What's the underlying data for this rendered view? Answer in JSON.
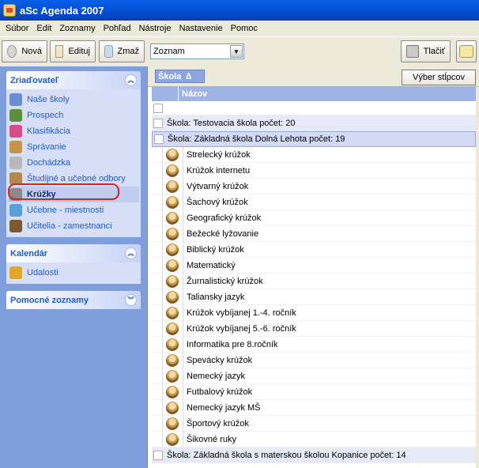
{
  "window": {
    "title": "aSc Agenda 2007"
  },
  "menu": [
    {
      "label": "Súbor",
      "icon": ""
    },
    {
      "label": "Edit",
      "icon": ""
    },
    {
      "label": "Zoznamy",
      "icon": ""
    },
    {
      "label": "Pohľad",
      "icon": ""
    },
    {
      "label": "Nástroje",
      "icon": ""
    },
    {
      "label": "Nastavenie",
      "icon": ""
    },
    {
      "label": "Pomoc",
      "icon": ""
    }
  ],
  "toolbar": {
    "new_label": "Nová",
    "edit_label": "Edituj",
    "delete_label": "Zmaž",
    "view_select": "Zoznam",
    "print_label": "Tlačiť"
  },
  "sidebar": {
    "panels": [
      {
        "title": "Zriaďovateľ",
        "items": [
          {
            "label": "Naše školy",
            "icon": "people-icon",
            "color": "#6a8fd0"
          },
          {
            "label": "Prospech",
            "icon": "grades-icon",
            "color": "#5c8f3c"
          },
          {
            "label": "Klasifikácia",
            "icon": "classification-icon",
            "color": "#d84a8a"
          },
          {
            "label": "Správanie",
            "icon": "behavior-icon",
            "color": "#c69443"
          },
          {
            "label": "Dochádzka",
            "icon": "attendance-icon",
            "color": "#b8b8b8"
          },
          {
            "label": "Študijné a učebné odbory",
            "icon": "book-icon",
            "color": "#b08a4a"
          },
          {
            "label": "Krúžky",
            "icon": "club-icon",
            "color": "#8a8a8a",
            "active": true
          },
          {
            "label": "Učebne - miestnosti",
            "icon": "room-icon",
            "color": "#5aa0d8"
          },
          {
            "label": "Učitelia - zamestnanci",
            "icon": "teacher-icon",
            "color": "#7a5a2a"
          }
        ]
      },
      {
        "title": "Kalendár",
        "items": [
          {
            "label": "Udalosti",
            "icon": "calendar-icon",
            "color": "#e5a626"
          }
        ]
      },
      {
        "title": "Pomocné zoznamy",
        "items": []
      }
    ]
  },
  "main": {
    "group_chip": "Škola",
    "group_chip_sort": "∆",
    "column_chooser": "Výber stĺpcov",
    "column_name": "Názov",
    "groups": [
      {
        "label": "Škola:  Testovacia škola  počet: 20",
        "selected": false,
        "items": []
      },
      {
        "label": "Škola:  Základná škola Dolná Lehota  počet: 19",
        "selected": true,
        "items": [
          "Strelecký krúžok",
          "Krúžok internetu",
          "Výtvarný krúžok",
          "Šachový krúžok",
          "Geografický krúžok",
          "Bežecké lyžovanie",
          "Biblický krúžok",
          "Matematický",
          "Žurnalistický krúžok",
          "Taliansky jazyk",
          "Krúžok vybíjanej 1.-4. ročník",
          "Krúžok vybíjanej 5.-6. ročník",
          "Informatika pre 8.ročník",
          "Spevácky krúžok",
          "Nemecký jazyk",
          "Futbalový krúžok",
          "Nemecký jazyk MŠ",
          "Športový krúžok",
          "Šikovné ruky"
        ]
      },
      {
        "label": "Škola:  Základná škola s materskou školou Kopanice  počet: 14",
        "selected": false,
        "items": []
      }
    ]
  }
}
